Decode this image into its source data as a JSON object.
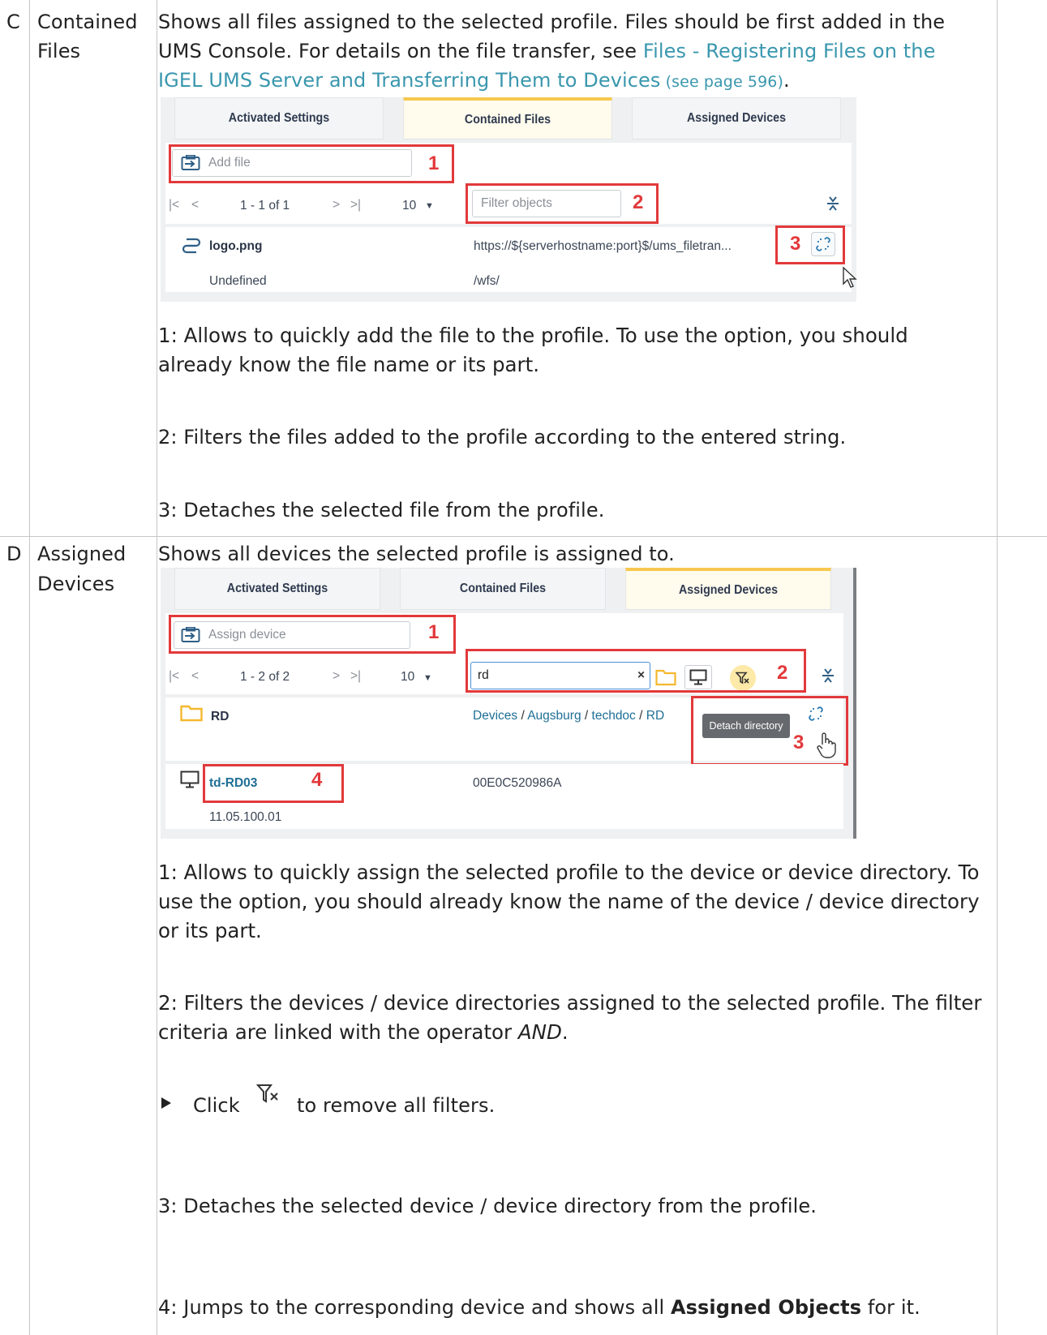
{
  "rows": [
    {
      "letter": "C",
      "term_line1": "Contained",
      "term_line2": "Files",
      "intro_line1": "Shows all files assigned to the selected profile. Files should be first added in the",
      "intro_line2a": "UMS Console. For details on the file transfer, see ",
      "link_part1": "Files - Registering Files on the",
      "link_part2": "IGEL UMS Server and Transferring Them to Devices",
      "link_page": " (see page 596)",
      "intro_end": ".",
      "note1": "1: Allows to quickly add the file to the profile. To use the option, you should already know the file name or its part.",
      "note2": "2: Filters the files added to the profile according to the entered string.",
      "note3": "3: Detaches the selected file from the profile."
    },
    {
      "letter": "D",
      "term_line1": "Assigned",
      "term_line2": "Devices",
      "intro_line1": "Shows all devices the selected profile is assigned to.",
      "note1": "1: Allows to quickly assign the selected profile to the device or device directory. To use the option, you should already know the name of the device / device directory or its part.",
      "note2_a": "2: Filters the devices / device directories assigned to the selected profile. The filter criteria are linked with the operator ",
      "note2_em": "AND",
      "note2_b": ".",
      "click_prefix": "Click",
      "click_suffix": "to remove all filters.",
      "note3": "3: Detaches the selected device / device directory from the profile.",
      "note4_a": "4: Jumps to the corresponding device and shows all ",
      "note4_bold": "Assigned Objects",
      "note4_b": " for it."
    }
  ],
  "shot1": {
    "tabs": [
      "Activated Settings",
      "Contained Files",
      "Assigned Devices"
    ],
    "active_tab": 1,
    "add_placeholder": "Add file",
    "pager": "1 - 1  of 1",
    "page_size": "10",
    "filter_placeholder": "Filter objects",
    "file_name": "logo.png",
    "file_url": "https://${serverhostname:port}$/ums_filetran...",
    "file_status": "Undefined",
    "file_path": "/wfs/",
    "callouts": [
      "1",
      "2",
      "3"
    ]
  },
  "shot2": {
    "tabs": [
      "Activated Settings",
      "Contained Files",
      "Assigned Devices"
    ],
    "active_tab": 2,
    "assign_placeholder": "Assign device",
    "pager": "1 - 2  of 2",
    "page_size": "10",
    "filter_value": "rd",
    "dir_name": "RD",
    "breadcrumb": [
      "Devices",
      "Augsburg",
      "techdoc",
      "RD"
    ],
    "tooltip": "Detach directory",
    "device_name": "td-RD03",
    "device_mac": "00E0C520986A",
    "device_version": "11.05.100.01",
    "callouts": [
      "1",
      "2",
      "3",
      "4"
    ]
  },
  "colors": {
    "callout_red": "#e2393b",
    "active_tab_accent": "#f6c84f",
    "link_teal": "#3a97ae",
    "folder_yellow": "#f5c342"
  }
}
